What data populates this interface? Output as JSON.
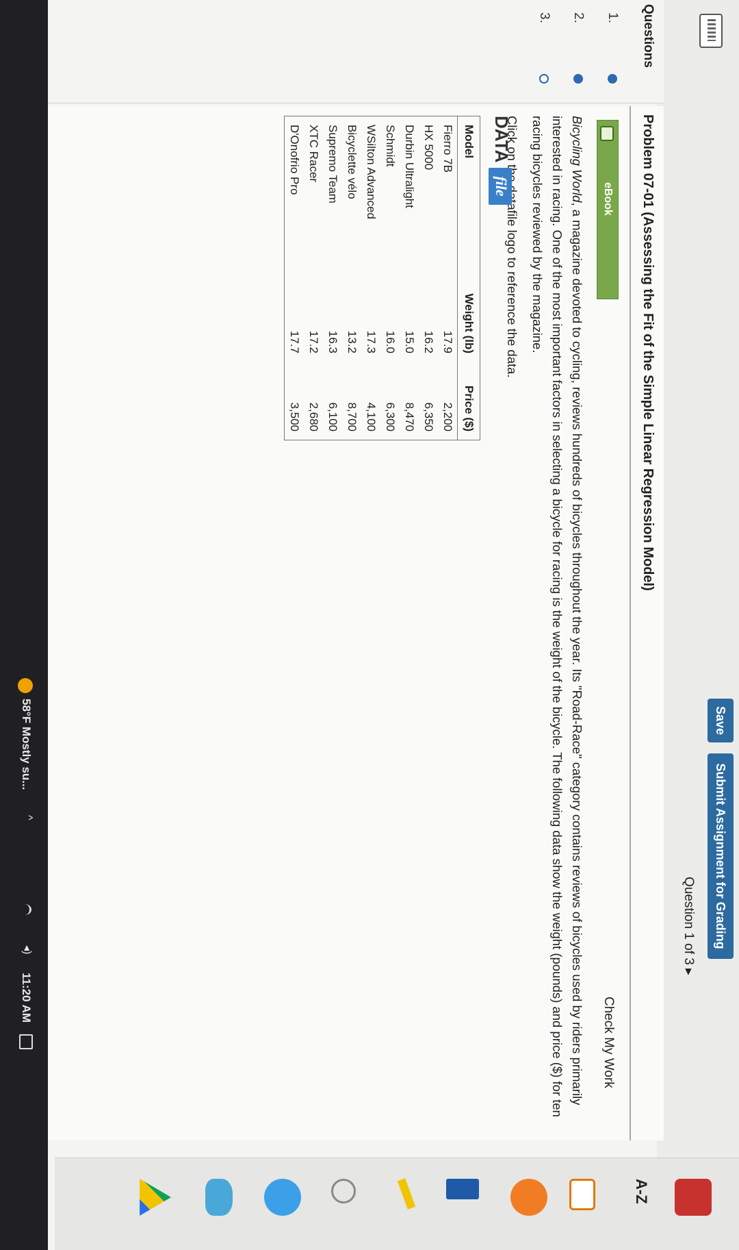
{
  "header": {
    "save_label": "Save",
    "submit_label": "Submit Assignment for Grading",
    "question_counter": "Question 1 of 3 ▸"
  },
  "tools": {
    "az_label": "A-Z"
  },
  "question_nav": {
    "title": "Questions",
    "items": [
      {
        "number": "1.",
        "state": "answered"
      },
      {
        "number": "2.",
        "state": "answered"
      },
      {
        "number": "3.",
        "state": "unanswered"
      }
    ]
  },
  "problem": {
    "title": "Problem 07-01 (Assessing the Fit of the Simple Linear Regression Model)",
    "check_my_work": "Check My Work",
    "ebook_label": "eBook",
    "intro_italic": "Bicycling World",
    "intro_rest": ", a magazine devoted to cycling, reviews hundreds of bicycles throughout the year. Its \"Road-Race\" category contains reviews of bicycles used by riders primarily interested in racing. One of the most important factors in selecting a bicycle for racing is the weight of the bicycle. The following data show the weight (pounds) and price ($) for ten racing bicycles reviewed by the magazine.",
    "click_note": "Click on the datafile logo to reference the data.",
    "datafile_word": "DATA",
    "datafile_badge": "file"
  },
  "table": {
    "headers": [
      "Model",
      "Weight (lb)",
      "Price ($)"
    ],
    "rows": [
      [
        "Fierro 7B",
        "17.9",
        "2,200"
      ],
      [
        "HX 5000",
        "16.2",
        "6,350"
      ],
      [
        "Durbin Ultralight",
        "15.0",
        "8,470"
      ],
      [
        "Schmidt",
        "16.0",
        "6,300"
      ],
      [
        "WSilton Advanced",
        "17.3",
        "4,100"
      ],
      [
        "Bicyclette vélo",
        "13.2",
        "8,700"
      ],
      [
        "Supremo Team",
        "16.3",
        "6,100"
      ],
      [
        "XTC Racer",
        "17.2",
        "2,680"
      ],
      [
        "D'Onofrio Pro",
        "17.7",
        "3,500"
      ]
    ]
  },
  "taskbar": {
    "weather": "58°F Mostly su...",
    "time": "11:20 AM"
  }
}
